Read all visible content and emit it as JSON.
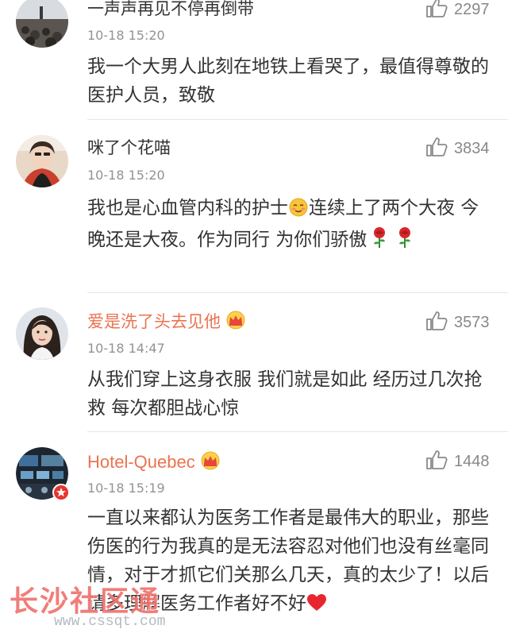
{
  "comments": [
    {
      "username": "一声声再见不停再倒带",
      "username_style": "normal",
      "time": "10-18 15:20",
      "likes": "2297",
      "text": "我一个大男人此刻在地铁上看哭了，最值得尊敬的医护人员，致敬",
      "avatar": "beach-rocks"
    },
    {
      "username": "咪了个花喵",
      "username_style": "normal",
      "time": "10-18 15:20",
      "likes": "3834",
      "text_part1": "我也是心血管内科的护士",
      "text_part2": "连续上了两个大夜 今晚还是大夜。作为同行 为你们骄傲",
      "emojis": [
        "smiling-emoji",
        "rose-emoji",
        "rose-emoji"
      ],
      "avatar": "person-selfie"
    },
    {
      "username": "爱是洗了头去见他",
      "username_style": "vip",
      "time": "10-18 14:47",
      "likes": "3573",
      "text": "从我们穿上这身衣服 我们就是如此 经历过几次抢救 每次都胆战心惊",
      "avatar": "woman-portrait"
    },
    {
      "username": "Hotel-Quebec",
      "username_style": "vip",
      "time": "10-18 15:19",
      "likes": "1448",
      "text": "一直以来都认为医务工作者是最伟大的职业，那些伤医的行为我真的是无法容忍对他们也没有丝毫同情，对于才抓它们关那么几天，真的太少了！以后请多理解医务工作者好不好",
      "emojis": [
        "heart-emoji"
      ],
      "avatar": "cockpit-verified"
    }
  ],
  "watermark": {
    "title": "长沙社区通",
    "url": "www.cssqt.com"
  },
  "colors": {
    "vip_name": "#eb7350",
    "time": "#939393",
    "like_count": "#888888",
    "watermark": "#f0736e"
  }
}
